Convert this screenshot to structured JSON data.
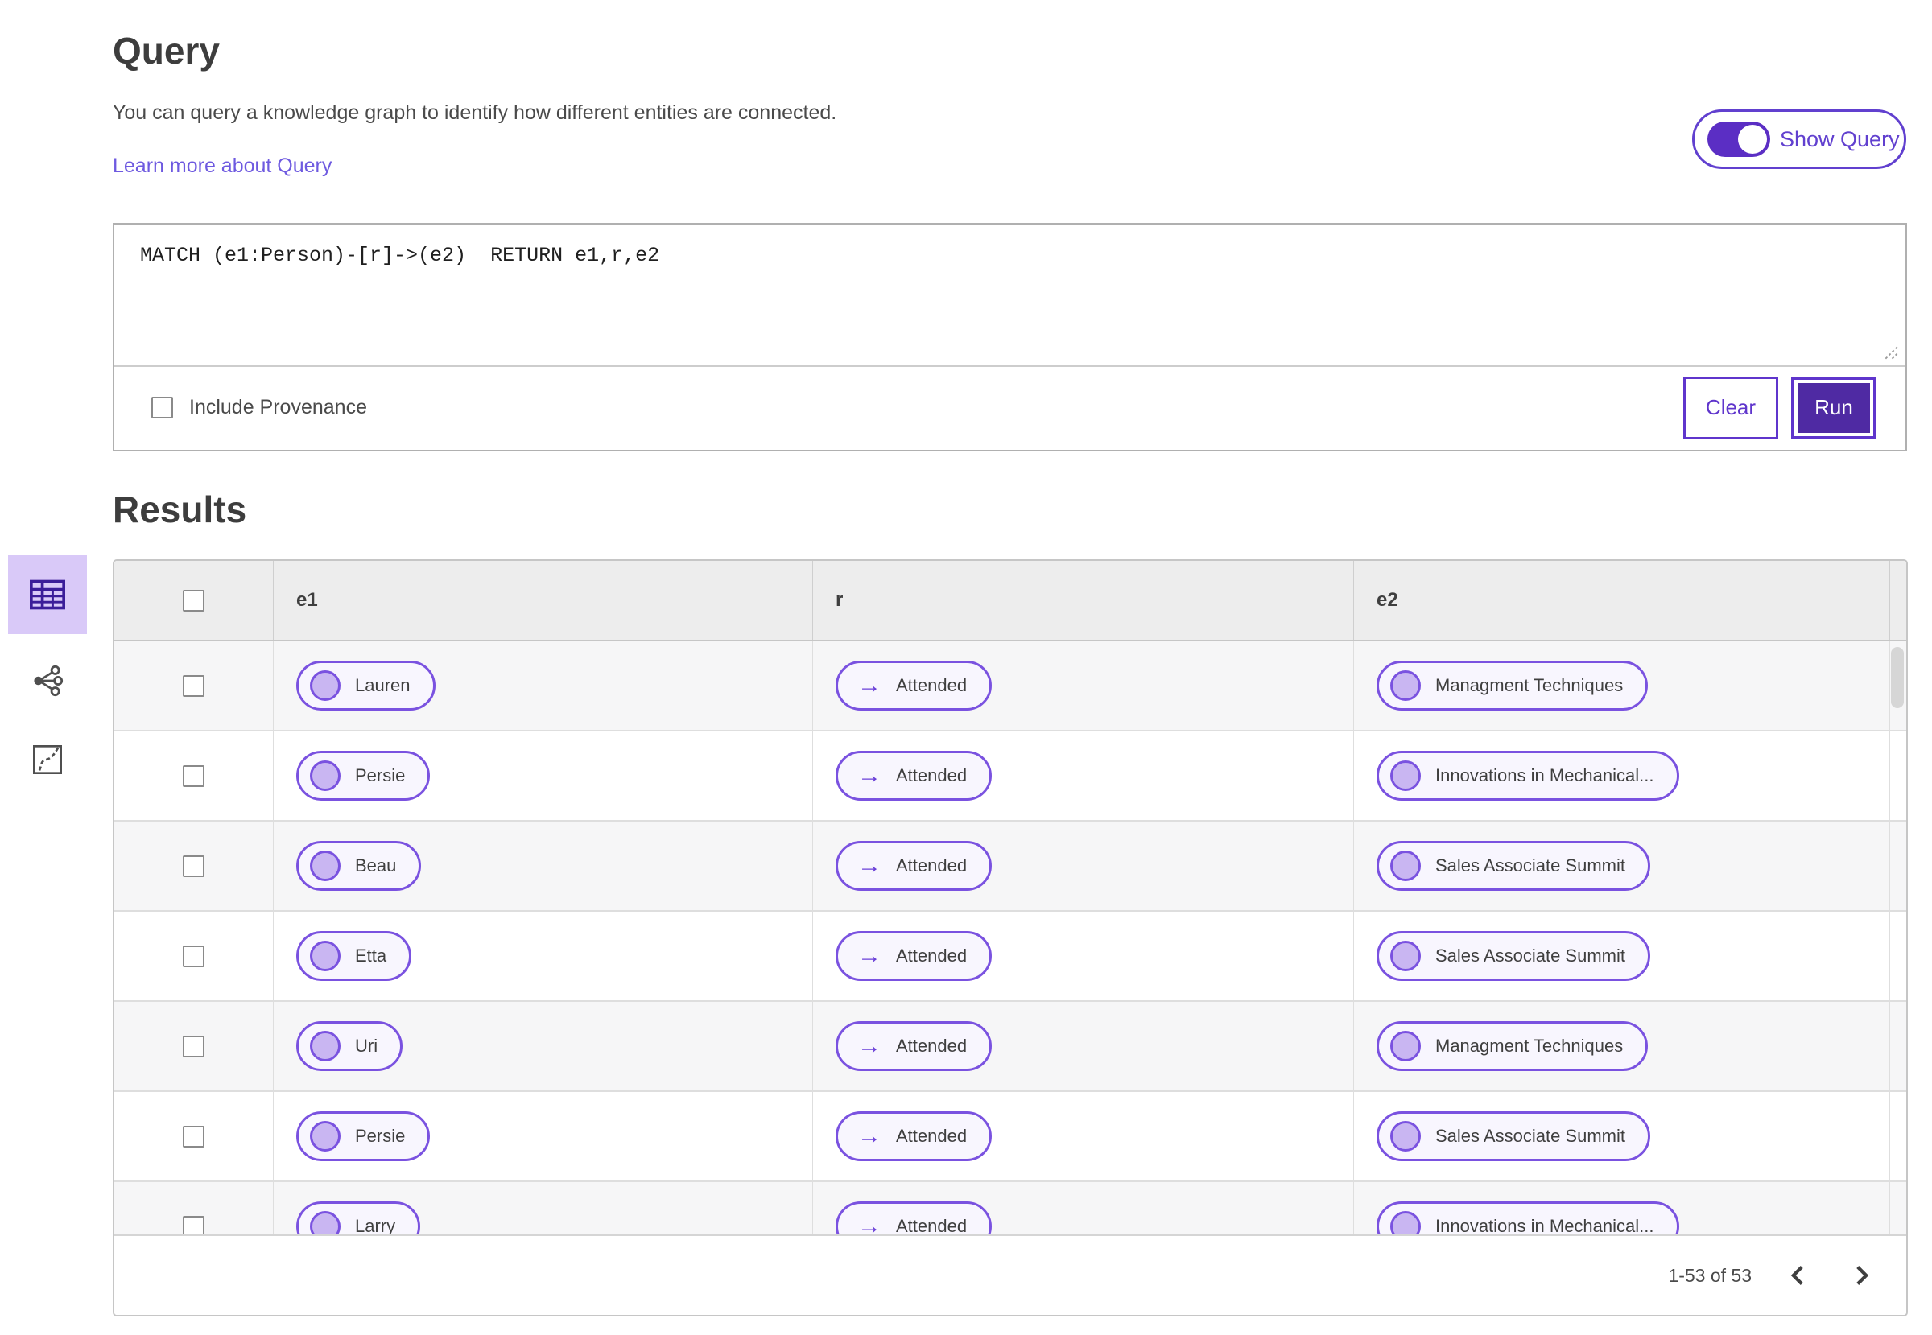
{
  "query_section": {
    "title": "Query",
    "description": "You can query a knowledge graph to identify how different entities are connected.",
    "learn_more_link": "Learn more about Query",
    "show_query_toggle": {
      "label": "Show Query",
      "state": "on"
    },
    "query_input_value": "MATCH (e1:Person)-[r]->(e2)  RETURN e1,r,e2",
    "include_provenance": {
      "label": "Include Provenance",
      "checked": false
    },
    "clear_button_label": "Clear",
    "run_button_label": "Run"
  },
  "results_section": {
    "title": "Results",
    "view_switcher": {
      "items": [
        "table-view",
        "network-view",
        "chart-view"
      ],
      "selected": "table-view"
    },
    "table": {
      "columns": [
        "e1",
        "r",
        "e2"
      ],
      "relation_arrow": "→",
      "rows": [
        {
          "e1": "Lauren",
          "r": "Attended",
          "e2": "Managment Techniques"
        },
        {
          "e1": "Persie",
          "r": "Attended",
          "e2": "Innovations in Mechanical..."
        },
        {
          "e1": "Beau",
          "r": "Attended",
          "e2": "Sales Associate Summit"
        },
        {
          "e1": "Etta",
          "r": "Attended",
          "e2": "Sales Associate Summit"
        },
        {
          "e1": "Uri",
          "r": "Attended",
          "e2": "Managment Techniques"
        },
        {
          "e1": "Persie",
          "r": "Attended",
          "e2": "Sales Associate Summit"
        },
        {
          "e1": "Larry",
          "r": "Attended",
          "e2": "Innovations in Mechanical..."
        }
      ]
    },
    "pagination": {
      "range_label": "1-53 of 53"
    }
  },
  "colors": {
    "accent_purple": "#5f35cc",
    "run_fill": "#4f2aa3",
    "chip_border": "#7a52e0",
    "chip_bg": "#f8f6fe",
    "chip_circle": "#c9b6f2",
    "selected_view_bg": "#d9c9f8",
    "link": "#6e5ae0",
    "header_bg": "#ededed",
    "stripe": "#f6f6f7"
  }
}
